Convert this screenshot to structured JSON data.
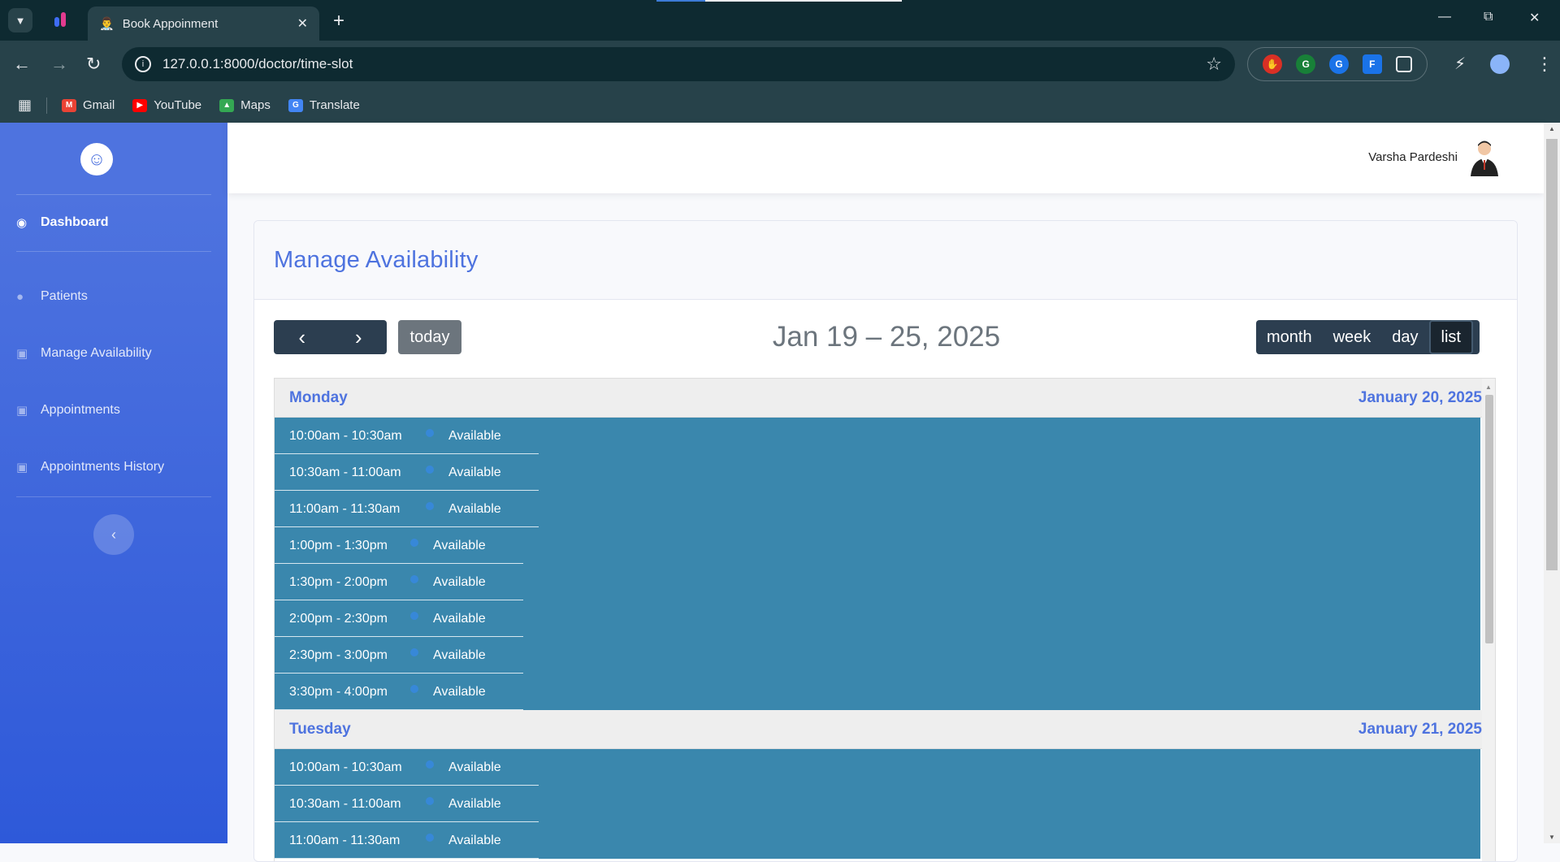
{
  "browser": {
    "tab_title": "Book Appoinment",
    "url": "127.0.0.1:8000/doctor/time-slot",
    "bookmarks": [
      {
        "label": "Gmail",
        "icon": "gmail-icon",
        "color": "#ea4335"
      },
      {
        "label": "YouTube",
        "icon": "youtube-icon",
        "color": "#ff0000"
      },
      {
        "label": "Maps",
        "icon": "maps-icon",
        "color": "#34a853"
      },
      {
        "label": "Translate",
        "icon": "translate-icon",
        "color": "#4285f4"
      }
    ]
  },
  "sidebar": {
    "items": [
      {
        "label": "Dashboard",
        "icon": "dashboard-icon"
      },
      {
        "label": "Patients",
        "icon": "user-icon"
      },
      {
        "label": "Manage Availability",
        "icon": "calendar-check-icon"
      },
      {
        "label": "Appointments",
        "icon": "calendar-icon"
      },
      {
        "label": "Appointments History",
        "icon": "calendar-icon"
      }
    ],
    "toggle_icon": "chevron-left-icon"
  },
  "topbar": {
    "user_name": "Varsha Pardeshi"
  },
  "card": {
    "title": "Manage Availability"
  },
  "calendar": {
    "prev_label": "<",
    "next_label": ">",
    "today_label": "today",
    "range_title": "Jan 19 – 25, 2025",
    "views": [
      "month",
      "week",
      "day",
      "list"
    ],
    "active_view": "list",
    "days": [
      {
        "name": "Monday",
        "date": "January 20, 2025",
        "slots": [
          {
            "time": "10:00am - 10:30am",
            "status": "Available"
          },
          {
            "time": "10:30am - 11:00am",
            "status": "Available"
          },
          {
            "time": "11:00am - 11:30am",
            "status": "Available"
          },
          {
            "time": "1:00pm - 1:30pm",
            "status": "Available"
          },
          {
            "time": "1:30pm - 2:00pm",
            "status": "Available"
          },
          {
            "time": "2:00pm - 2:30pm",
            "status": "Available"
          },
          {
            "time": "2:30pm - 3:00pm",
            "status": "Available"
          },
          {
            "time": "3:30pm - 4:00pm",
            "status": "Available"
          }
        ]
      },
      {
        "name": "Tuesday",
        "date": "January 21, 2025",
        "slots": [
          {
            "time": "10:00am - 10:30am",
            "status": "Available"
          },
          {
            "time": "10:30am - 11:00am",
            "status": "Available"
          },
          {
            "time": "11:00am - 11:30am",
            "status": "Available"
          }
        ]
      }
    ]
  },
  "colors": {
    "sidebar_top": "#4e73df",
    "sidebar_bottom": "#2e59d9",
    "event_bg": "#3a87ad",
    "primary": "#4e73df",
    "toolbar_btn": "#2c3e50"
  }
}
